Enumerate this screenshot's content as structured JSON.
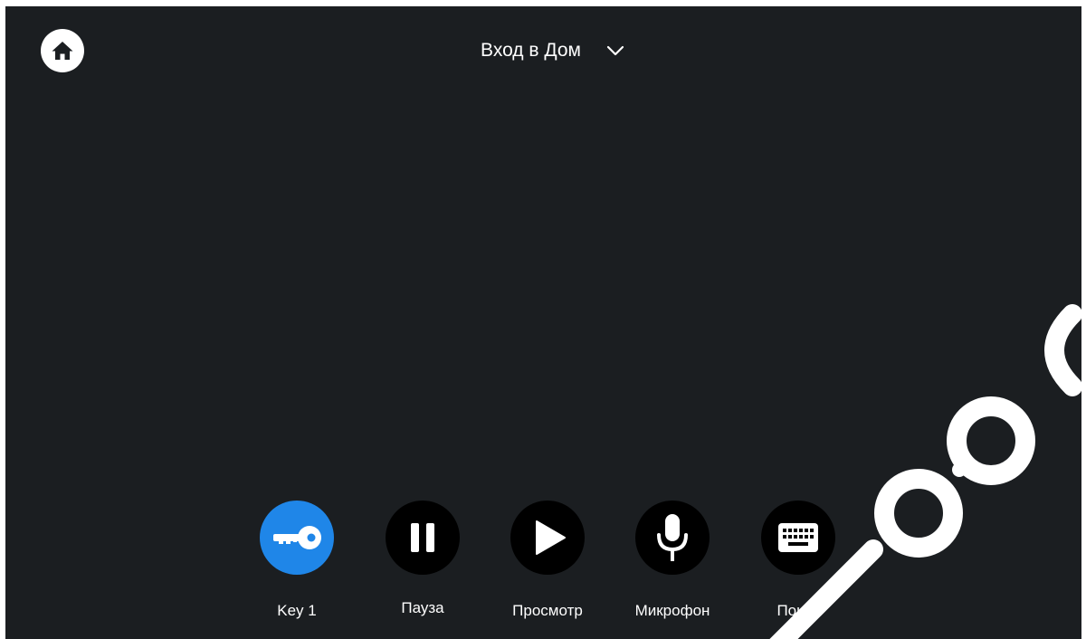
{
  "header": {
    "home_icon": "home-icon",
    "title": "Вход в Дом",
    "dropdown_icon": "chevron-down-icon"
  },
  "controls": [
    {
      "label": "Key 1",
      "icon": "key-icon",
      "active": true,
      "accent": "#1f86e8"
    },
    {
      "label": "Пауза",
      "icon": "pause-icon",
      "active": false
    },
    {
      "label": "Просмотр",
      "icon": "play-icon",
      "active": false
    },
    {
      "label": "Микрофон",
      "icon": "microphone-icon",
      "active": false
    },
    {
      "label": "Поиск",
      "icon": "keyboard-icon",
      "active": false
    }
  ],
  "colors": {
    "background": "#1b1e21",
    "button": "#000000",
    "accent": "#1f86e8"
  }
}
